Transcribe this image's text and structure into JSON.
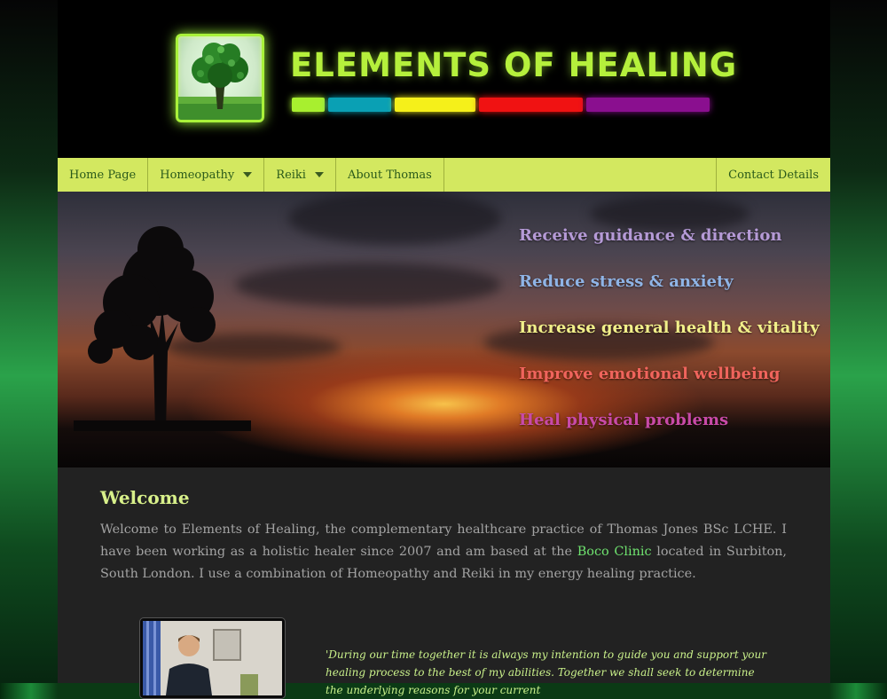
{
  "header": {
    "site_title": "ELEMENTS OF HEALING",
    "logo": {
      "icon": "tree-icon"
    },
    "color_bars": [
      "#a8ef2f",
      "#0aa0b4",
      "#f5f01a",
      "#f01212",
      "#8a0f8f"
    ]
  },
  "nav": {
    "items": [
      {
        "label": "Home Page",
        "has_dropdown": false
      },
      {
        "label": "Homeopathy",
        "has_dropdown": true
      },
      {
        "label": "Reiki",
        "has_dropdown": true
      },
      {
        "label": "About Thomas",
        "has_dropdown": false
      }
    ],
    "contact_label": "Contact Details"
  },
  "banner": {
    "taglines": [
      {
        "text": "Receive guidance & direction",
        "color": "#b59ad6"
      },
      {
        "text": "Reduce stress & anxiety",
        "color": "#8fb4e6"
      },
      {
        "text": "Increase general health & vitality",
        "color": "#f2f08a"
      },
      {
        "text": "Improve emotional wellbeing",
        "color": "#f0645c"
      },
      {
        "text": "Heal physical problems",
        "color": "#c84aa8"
      }
    ]
  },
  "welcome": {
    "title": "Welcome",
    "text_before_link": "Welcome to Elements of Healing, the complementary healthcare practice of Thomas Jones BSc LCHE. I have been working as a holistic healer since 2007 and am based at the ",
    "link_text": "Boco Clinic",
    "text_after_link": " located in Surbiton, South London. I use a combination of Homeopathy and Reiki in my energy healing practice."
  },
  "quote": {
    "text": "'During our time together it is always my intention to guide you and support your healing process to the best of my abilities. Together we shall seek to determine the underlying reasons for your current"
  }
}
